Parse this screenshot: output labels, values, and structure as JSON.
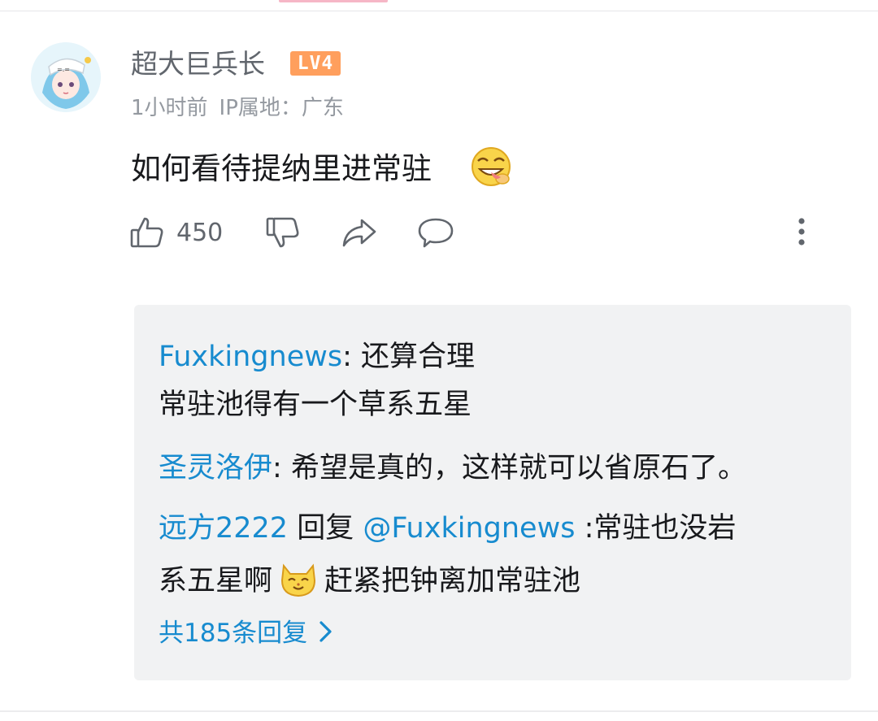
{
  "comment": {
    "username": "超大巨兵长",
    "level": "LV4",
    "time": "1小时前",
    "ip_location": "IP属地：广东",
    "text": "如何看待提纳里进常驻",
    "like_count": "450",
    "emoji": "grinning-tongue-emoji"
  },
  "replies": {
    "items": [
      {
        "user": "Fuxkingnews",
        "sep": ": ",
        "text_line1": "还算合理",
        "text_line2": "常驻池得有一个草系五星"
      },
      {
        "user": "圣灵洛伊",
        "sep": ": ",
        "text": "希望是真的，这样就可以省原石了。"
      },
      {
        "user": "远方2222",
        "reply_word": " 回复 ",
        "mention": "@Fuxkingnews",
        "text_line1": " :常驻也没岩",
        "text_line2_a": "系五星啊",
        "emoji": "cat-emoji",
        "text_line2_b": "赶紧把钟离加常驻池"
      }
    ],
    "view_all": "共185条回复"
  },
  "colors": {
    "link": "#178bcf",
    "level_badge": "#ff9f5d",
    "reply_box_bg": "#f1f2f3",
    "secondary_text": "#9499a0"
  },
  "icons": [
    "thumbs-up-icon",
    "thumbs-down-icon",
    "share-icon",
    "comment-icon",
    "more-vertical-icon",
    "chevron-right-icon"
  ]
}
